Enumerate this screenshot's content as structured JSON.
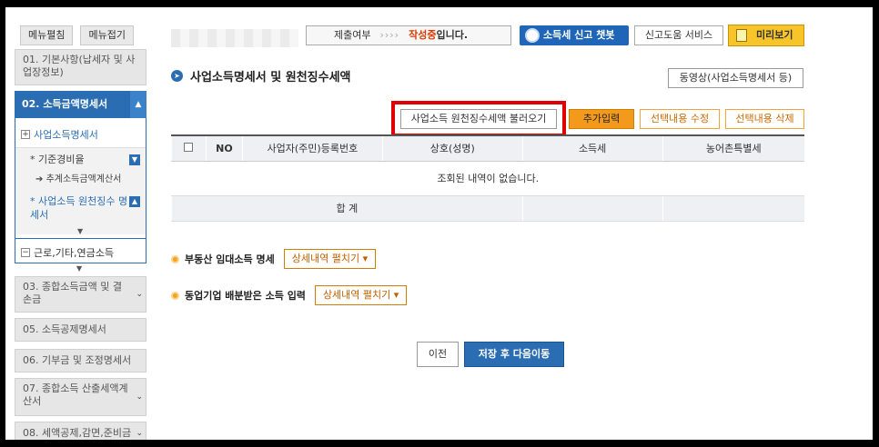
{
  "sidebar": {
    "expand_all": "메뉴펼침",
    "collapse_all": "메뉴접기",
    "step01": "01. 기본사항(납세자 및 사업장정보)",
    "step02": {
      "title": "02. 소득금액명세서",
      "business_income": "사업소득명세서",
      "standard_expense": "기준경비율",
      "estimated_income": "추계소득금액계산서",
      "withholding": "사업소득 원천징수 명세서",
      "other_income": "근로,기타,연금소득"
    },
    "step03": "03. 종합소득금액 및 결손금",
    "step05": "05. 소득공제명세서",
    "step06": "06. 기부금 및 조정명세서",
    "step07": "07. 종합소득 산출세액계산서",
    "step08": "08. 세액공제,감면,준비금"
  },
  "header": {
    "status_label": "제출여부",
    "status_arrows": "››››",
    "status_value": "작성중",
    "status_suffix": "입니다.",
    "chatbot": "소득세 신고 챗봇",
    "help": "신고도움 서비스",
    "preview": "미리보기"
  },
  "main": {
    "title": "사업소득명세서 및 원천징수세액",
    "video": "동영상(사업소득명세서 등)",
    "load_withholding": "사업소득 원천징수세액 불러오기",
    "add_input": "추가입력",
    "edit_selected": "선택내용 수정",
    "delete_selected": "선택내용 삭제",
    "table": {
      "headers": [
        "NO",
        "사업자(주민)등록번호",
        "상호(성명)",
        "소득세",
        "농어촌특별세"
      ],
      "empty_message": "조회된 내역이 없습니다.",
      "total_label": "합 계"
    },
    "rental_label": "부동산 임대소득 명세",
    "rental_expand": "상세내역 펼치기 ▾",
    "partnership_label": "동업기업 배분받은 소득 입력",
    "partnership_expand": "상세내역 펼치기 ▾",
    "prev": "이전",
    "save_next": "저장 후 다음이동"
  }
}
